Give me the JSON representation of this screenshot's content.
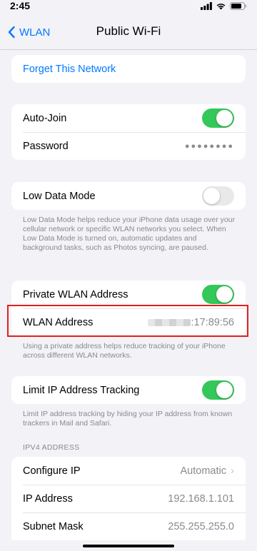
{
  "status_bar": {
    "time": "2:45"
  },
  "nav": {
    "back_label": "WLAN",
    "title": "Public Wi-Fi"
  },
  "forget": {
    "label": "Forget This Network"
  },
  "join_group": {
    "auto_join_label": "Auto-Join",
    "auto_join_on": true,
    "password_label": "Password",
    "password_value": "●●●●●●●●"
  },
  "low_data": {
    "label": "Low Data Mode",
    "on": false,
    "footnote": "Low Data Mode helps reduce your iPhone data usage over your cellular network or specific WLAN networks you select. When Low Data Mode is turned on, automatic updates and background tasks, such as Photos syncing, are paused."
  },
  "private_group": {
    "private_label": "Private WLAN Address",
    "private_on": true,
    "address_label": "WLAN Address",
    "address_value": ":17:89:56",
    "footnote": "Using a private address helps reduce tracking of your iPhone across different WLAN networks."
  },
  "limit_ip": {
    "label": "Limit IP Address Tracking",
    "on": true,
    "footnote": "Limit IP address tracking by hiding your IP address from known trackers in Mail and Safari."
  },
  "ipv4": {
    "header": "IPV4 ADDRESS",
    "configure_label": "Configure IP",
    "configure_value": "Automatic",
    "ip_label": "IP Address",
    "ip_value": "192.168.1.101",
    "subnet_label": "Subnet Mask",
    "subnet_value": "255.255.255.0"
  },
  "colors": {
    "accent": "#007aff",
    "toggle_on": "#34c759",
    "highlight": "#e02020",
    "background": "#f2f2f7"
  }
}
